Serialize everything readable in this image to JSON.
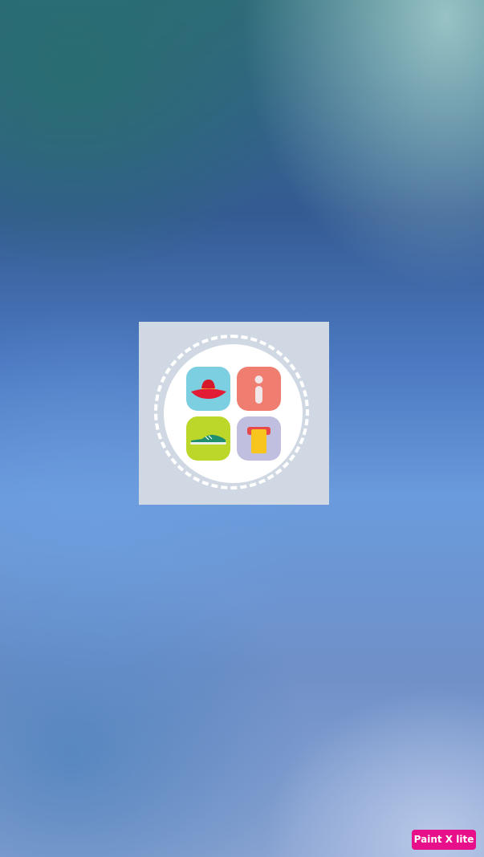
{
  "splash": {
    "icons": [
      {
        "name": "hat-icon",
        "color": "#7ccfe0"
      },
      {
        "name": "info-icon",
        "color": "#ef7e70"
      },
      {
        "name": "shoe-icon",
        "color": "#bcd62a"
      },
      {
        "name": "shirt-icon",
        "color": "#c1bfe0"
      }
    ]
  },
  "watermark": {
    "label": "Paint X lite",
    "color": "#e8108a"
  }
}
